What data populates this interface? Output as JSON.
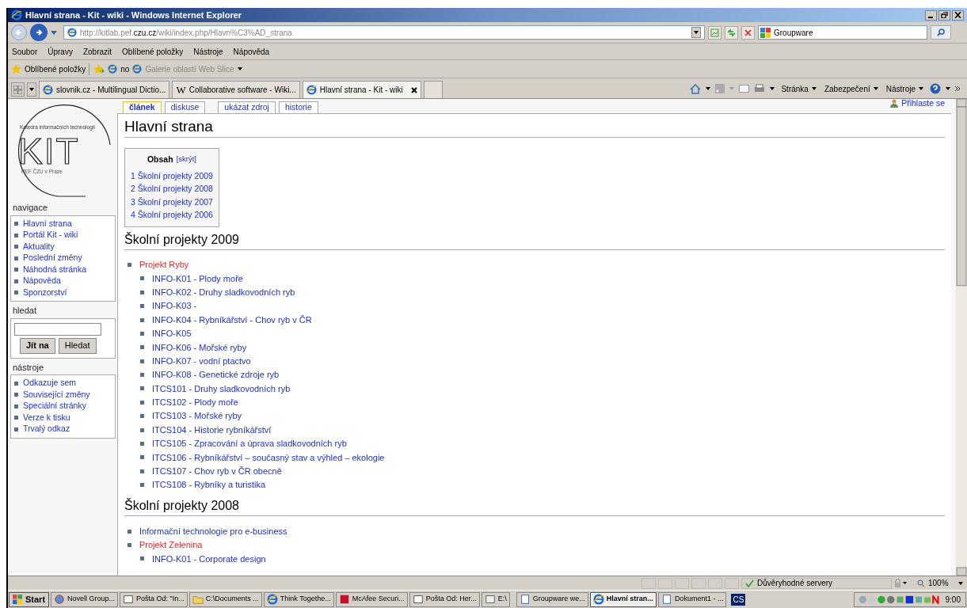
{
  "window": {
    "title": "Hlavní strana - Kit - wiki - Windows Internet Explorer"
  },
  "address_bar": {
    "url_pre": "http://kitlab.pef.",
    "url_host": "czu.cz",
    "url_post": "/wiki/index.php/Hlavn%C3%AD_strana"
  },
  "search_field": {
    "value": "Groupware"
  },
  "menu_bar": [
    "Soubor",
    "Úpravy",
    "Zobrazit",
    "Oblíbené položky",
    "Nástroje",
    "Nápověda"
  ],
  "favorites_bar": {
    "label": "Oblíbené položky",
    "items": [
      {
        "label": "no",
        "disabled": false
      },
      {
        "label": "Galerie oblastí Web Slice",
        "disabled": true
      }
    ]
  },
  "browser_tabs": [
    {
      "label": "slovnik.cz - Multilingual Dictio...",
      "selected": false,
      "kind": "ie"
    },
    {
      "label": "Collaborative software - Wiki...",
      "selected": false,
      "kind": "wiki",
      "icon_glyph": "W"
    },
    {
      "label": "Hlavní strana - Kit - wiki",
      "selected": true,
      "kind": "ie"
    }
  ],
  "command_bar": [
    "Stránka",
    "Zabezpečení",
    "Nástroje"
  ],
  "logo": {
    "letters": "KIT",
    "top_text": "Katedra informačních technologií",
    "bottom_text": "PEF ČZU v Praze"
  },
  "user_link": "Přihlaste se",
  "page_tabs": [
    {
      "label": "článek",
      "selected": true
    },
    {
      "label": "diskuse",
      "selected": false
    },
    {
      "label": "ukázat zdroj",
      "selected": false
    },
    {
      "label": "historie",
      "selected": false
    }
  ],
  "sidebar": {
    "sections": [
      {
        "title": "navigace",
        "kind": "links",
        "items": [
          "Hlavní strana",
          "Portál Kit - wiki",
          "Aktuality",
          "Poslední změny",
          "Náhodná stránka",
          "Nápověda",
          "Sponzorství"
        ]
      },
      {
        "title": "hledat",
        "kind": "search",
        "buttons": [
          "Jít na",
          "Hledat"
        ]
      },
      {
        "title": "nástroje",
        "kind": "links",
        "items": [
          "Odkazuje sem",
          "Související změny",
          "Speciální stránky",
          "Verze k tisku",
          "Trvalý odkaz"
        ]
      }
    ]
  },
  "page": {
    "title": "Hlavní strana",
    "toc": {
      "title": "Obsah",
      "toggle": "[skrýt]",
      "items": [
        "1 Školní projekty 2009",
        "2 Školní projekty 2008",
        "3 Školní projekty 2007",
        "4 Školní projekty 2006"
      ]
    },
    "sections": [
      {
        "heading": "Školní projekty 2009",
        "items": [
          {
            "label": "Projekt Ryby",
            "exists": false,
            "children": [
              {
                "label": "INFO-K01 - Plody moře",
                "exists": true
              },
              {
                "label": "INFO-K02 - Druhy sladkovodních ryb",
                "exists": true
              },
              {
                "label": "INFO-K03 -",
                "exists": true
              },
              {
                "label": "INFO-K04 - Rybníkářství - Chov ryb v ČR",
                "exists": true
              },
              {
                "label": "INFO-K05",
                "exists": true
              },
              {
                "label": "INFO-K06 - Mořské ryby",
                "exists": true
              },
              {
                "label": "INFO-K07 - vodní ptactvo",
                "exists": true
              },
              {
                "label": "INFO-K08 - Genetické zdroje ryb",
                "exists": true
              },
              {
                "label": "ITCS101 - Druhy sladkovodních ryb",
                "exists": true
              },
              {
                "label": "ITCS102 - Plody moře",
                "exists": true
              },
              {
                "label": "ITCS103 - Mořské ryby",
                "exists": true
              },
              {
                "label": "ITCS104 - Historie rybníkářství",
                "exists": true
              },
              {
                "label": "ITCS105 - Zpracování a úprava sladkovodních ryb",
                "exists": true
              },
              {
                "label": "ITCS106 - Rybníkářství – současný stav a výhled – ekologie",
                "exists": true
              },
              {
                "label": "ITCS107 - Chov ryb v ČR obecně",
                "exists": true
              },
              {
                "label": "ITCS108 - Rybníky a turistika",
                "exists": true
              }
            ]
          }
        ]
      },
      {
        "heading": "Školní projekty 2008",
        "items": [
          {
            "label": "Informační technologie pro e-business",
            "exists": true
          },
          {
            "label": "Projekt Zelenina",
            "exists": false,
            "children": [
              {
                "label": "INFO-K01 - Corporate design",
                "exists": true
              }
            ]
          }
        ]
      }
    ]
  },
  "status_bar": {
    "zone": "Důvěryhodné servery",
    "zoom": "100%"
  },
  "taskbar": {
    "start": "Start",
    "buttons": [
      {
        "label": "Novell Group...",
        "selected": false,
        "kind": "globe"
      },
      {
        "label": "Pošta Od: \"In...",
        "selected": false,
        "kind": "mail"
      },
      {
        "label": "C:\\Documents ...",
        "selected": false,
        "kind": "folder"
      },
      {
        "label": "Think Togethe...",
        "selected": false,
        "kind": "ie"
      },
      {
        "label": "McAfee Securi...",
        "selected": false,
        "kind": "mcafee"
      },
      {
        "label": "Pošta Od: Her...",
        "selected": false,
        "kind": "mail"
      },
      {
        "label": "E:\\",
        "selected": false,
        "kind": "drive"
      },
      {
        "label": "Groupware we...",
        "selected": false,
        "kind": "doc"
      },
      {
        "label": "Hlavní stran...",
        "selected": true,
        "kind": "ie"
      },
      {
        "label": "Dokument1 - ...",
        "selected": false,
        "kind": "doc"
      }
    ],
    "language": "CS",
    "clock": "9:00"
  }
}
